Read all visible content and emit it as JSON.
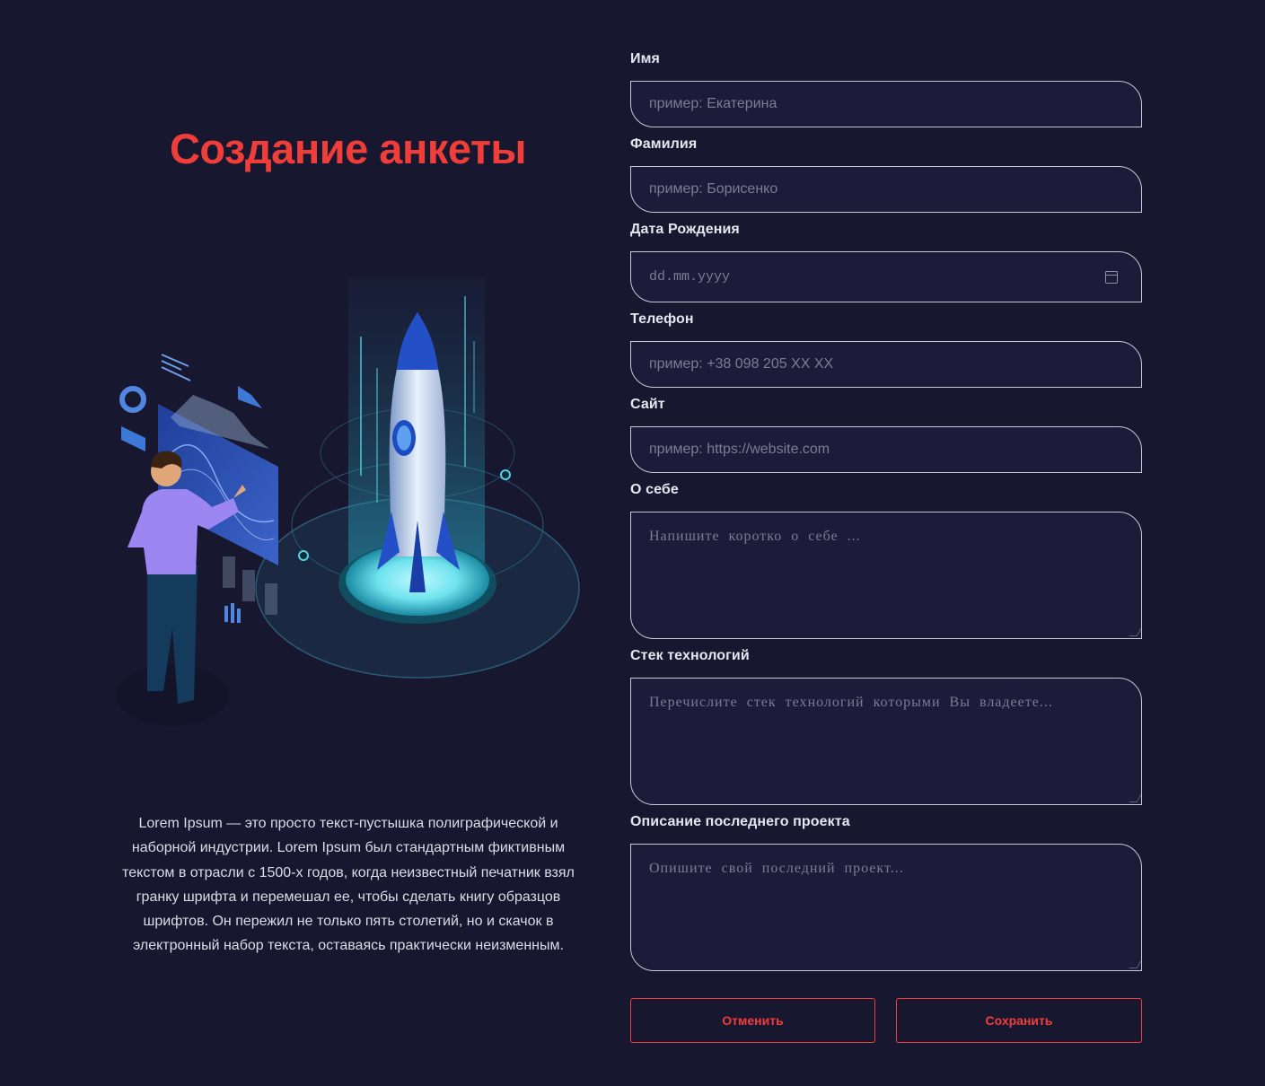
{
  "page": {
    "title": "Создание анкеты",
    "description": "Lorem Ipsum — это просто текст-пустышка полиграфической и наборной индустрии. Lorem Ipsum был стандартным фиктивным текстом в отрасли с 1500-х годов, когда неизвестный печатник взял гранку шрифта и перемешал ее, чтобы сделать книгу образцов шрифтов. Он пережил не только пять столетий, но и скачок в электронный набор текста, оставаясь практически неизменным."
  },
  "form": {
    "first_name": {
      "label": "Имя",
      "placeholder": "пример: Екатерина"
    },
    "last_name": {
      "label": "Фамилия",
      "placeholder": "пример: Борисенко"
    },
    "birth_date": {
      "label": "Дата Рождения",
      "placeholder": "dd.mm.yyyy"
    },
    "phone": {
      "label": "Телефон",
      "placeholder": "пример: +38 098 205 XX XX"
    },
    "website": {
      "label": "Сайт",
      "placeholder": "пример: https://website.com"
    },
    "about": {
      "label": "О себе",
      "placeholder": "Напишите коротко о себе ..."
    },
    "tech_stack": {
      "label": "Стек технологий",
      "placeholder": "Перечислите стек технологий которыми Вы владеете..."
    },
    "last_project": {
      "label": "Описание последнего проекта",
      "placeholder": "Опишите свой последний проект..."
    }
  },
  "buttons": {
    "cancel": "Отменить",
    "save": "Сохранить"
  },
  "colors": {
    "background": "#181730",
    "accent": "#ef3e3a",
    "input_bg": "#1c1b3a",
    "input_border": "#c9c9d3"
  }
}
